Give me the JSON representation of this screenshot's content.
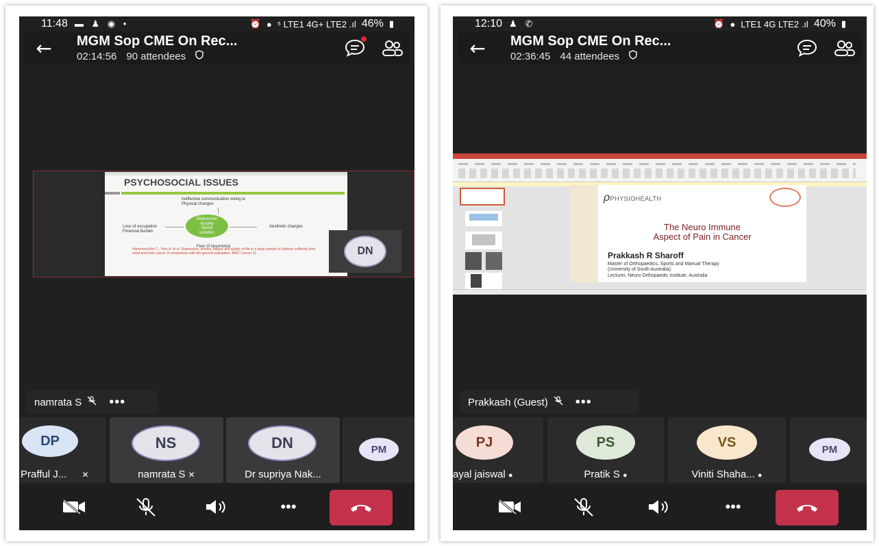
{
  "colors": {
    "hangup": "#c4314b",
    "background": "#202020"
  },
  "left": {
    "status": {
      "time": "11:48",
      "battery": "46%",
      "indicators": "⁵ LTE1 4G+ LTE2 .ıl"
    },
    "meeting": {
      "title": "MGM Sop CME On Rec...",
      "duration": "02:14:56",
      "attendees": "90 attendees"
    },
    "slide": {
      "title": "PSYCHOSOCIAL ISSUES",
      "top_text": "Ineffective communication owing to Physical changes",
      "center_lines": [
        "Depression",
        "Anxiety",
        "Social",
        "isolation"
      ],
      "left_text": "Loss of occupation Financial burden",
      "right_text": "Aesthetic changes",
      "bottom_text": "Fear of recurrence",
      "citation": "Hammermuller C., Hinz A. et al. Depression, anxiety, fatigue and quality of life in a large sample of patients suffering from head and neck cancer in comparison with the general population. BMC Cancer 21"
    },
    "pip_avatar": "DN",
    "active_speaker": "namrata S",
    "participants": [
      {
        "initials": "DP",
        "name": "Prafful  J...",
        "bg": "#d9e4f4",
        "fg": "#2e4a78"
      },
      {
        "initials": "NS",
        "name": "namrata S",
        "bg": "#e3e3ea",
        "fg": "#3d3d55"
      },
      {
        "initials": "DN",
        "name": "Dr supriya Nak...",
        "bg": "#e3e3ea",
        "fg": "#3d3d55"
      },
      {
        "initials": "PM",
        "name": "",
        "bg": "#e6e4f6",
        "fg": "#4a4870"
      }
    ]
  },
  "right": {
    "status": {
      "time": "12:10",
      "battery": "40%",
      "indicators": "LTE1 4G LTE2 .ıl"
    },
    "meeting": {
      "title": "MGM Sop CME On Rec...",
      "duration": "02:36:45",
      "attendees": "44 attendees"
    },
    "slide": {
      "logo": "PHYSIOHEALTH",
      "title_line1": "The Neuro Immune",
      "title_line2": "Aspect of Pain in Cancer",
      "presenter": "Prakkash R Sharoff",
      "detail1": "Master of Orthopaedics, Sports and Manual Therapy",
      "detail2": "(University of South Australia)",
      "detail3": "Lecturer, Neuro Orthopaedic Institute, Australia"
    },
    "active_speaker": "Prakkash (Guest)",
    "participants": [
      {
        "initials": "PJ",
        "name": "ayal jaiswal",
        "bg": "#f5dcd4",
        "fg": "#7a3520"
      },
      {
        "initials": "PS",
        "name": "Pratik S",
        "bg": "#dfe9da",
        "fg": "#3c5a31"
      },
      {
        "initials": "VS",
        "name": "Viniti Shaha...",
        "bg": "#f8e7cc",
        "fg": "#7a5219"
      },
      {
        "initials": "PM",
        "name": "",
        "bg": "#e6e4f6",
        "fg": "#4a4870"
      }
    ]
  }
}
